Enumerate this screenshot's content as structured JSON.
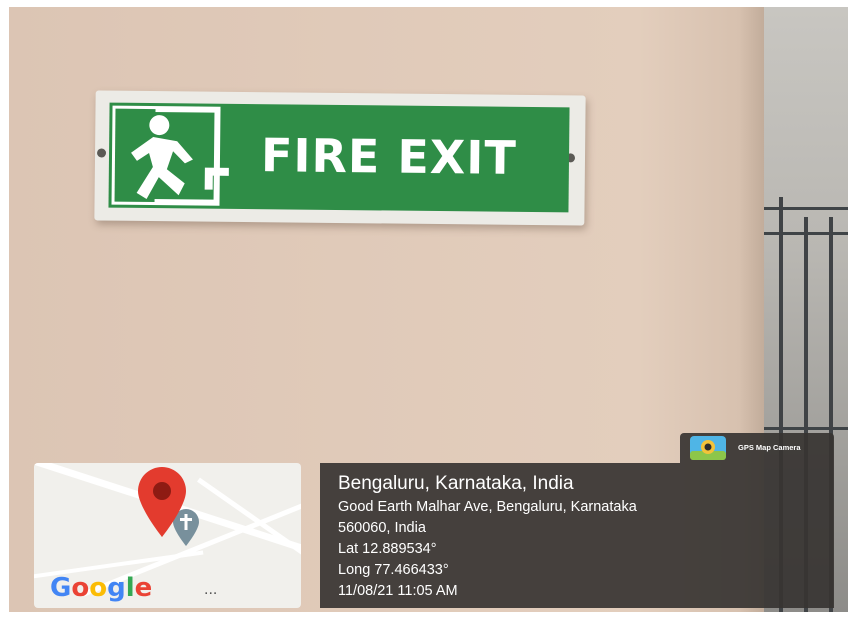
{
  "sign": {
    "text": "FIRE EXIT",
    "icon": "running-man-exit-icon",
    "colors": {
      "panel": "#2f8d47",
      "frame": "#ecebe6"
    }
  },
  "app_badge": {
    "label": "GPS Map Camera",
    "icon": "gps-camera-icon"
  },
  "map": {
    "brand": [
      "G",
      "o",
      "o",
      "g",
      "l",
      "e"
    ],
    "brand_colors": [
      "#4285f4",
      "#ea4335",
      "#fbbc05",
      "#4285f4",
      "#34a853",
      "#ea4335"
    ],
    "more": "...",
    "pin_color": "#e33b2e",
    "poi_icon": "church-pin-icon"
  },
  "location": {
    "title": "Bengaluru, Karnataka, India",
    "address_line1": "Good Earth Malhar Ave, Bengaluru, Karnataka",
    "address_line2": "560060, India",
    "lat": "Lat 12.889534°",
    "long": "Long 77.466433°",
    "datetime": "11/08/21 11:05 AM"
  }
}
